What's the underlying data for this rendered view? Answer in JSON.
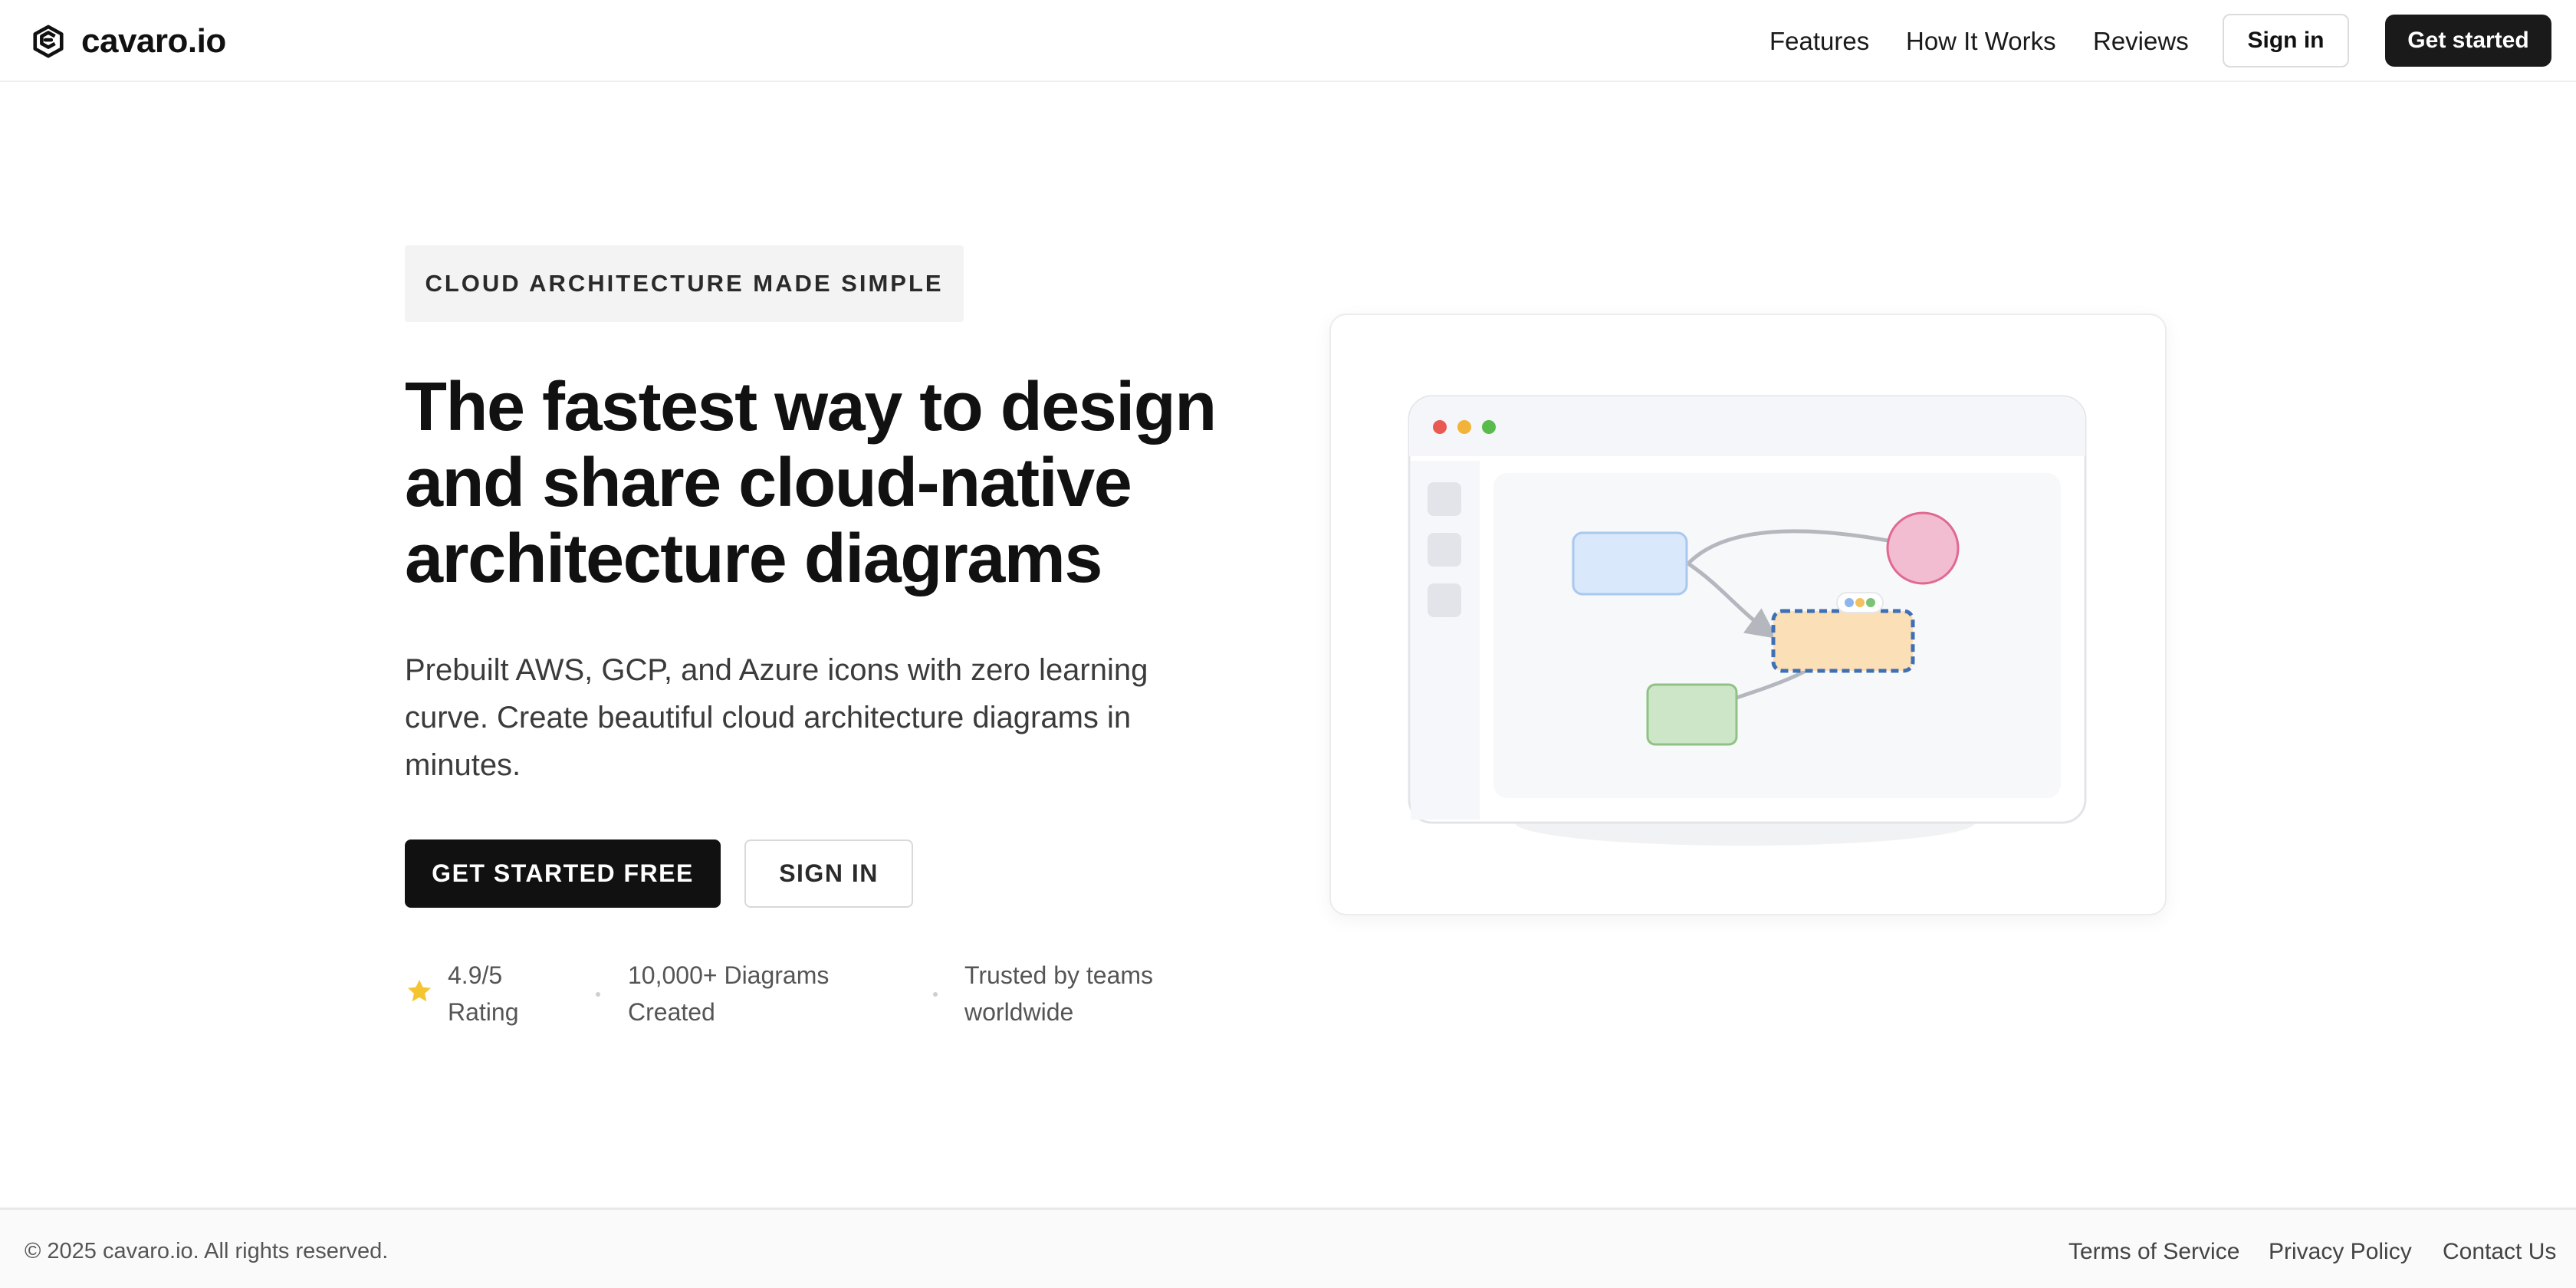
{
  "nav": {
    "brand": "cavaro.io",
    "links": [
      "Features",
      "How It Works",
      "Reviews"
    ],
    "sign_in": "Sign in",
    "get_started": "Get started"
  },
  "hero": {
    "eyebrow": "CLOUD ARCHITECTURE MADE SIMPLE",
    "headline_lines": [
      "The fastest way to design",
      "and share cloud-native",
      "architecture diagrams"
    ],
    "subhead_lines": [
      "Prebuilt AWS, GCP, and Azure icons with zero learning",
      "curve. Create beautiful cloud architecture diagrams in",
      "minutes."
    ],
    "cta_primary": "GET STARTED FREE",
    "cta_secondary": "SIGN IN",
    "stats": [
      {
        "line1": "4.9/5",
        "line2": "Rating"
      },
      {
        "line1": "10,000+ Diagrams",
        "line2": "Created"
      },
      {
        "line1": "Trusted by teams",
        "line2": "worldwide"
      }
    ]
  },
  "footer": {
    "copyright": "© 2025 cavaro.io. All rights reserved.",
    "links": [
      "Terms of Service",
      "Privacy Policy",
      "Contact Us"
    ]
  },
  "colors": {
    "accent": "#111111",
    "star": "#f5c531",
    "node_blue": "#d9e8fb",
    "node_pink": "#f2bcd1",
    "node_orange": "#fbdfb6",
    "node_green": "#cde6c8",
    "selection": "#3f6fb4"
  },
  "icons": {
    "brand": "cube-logo-icon",
    "rating": "star-icon"
  }
}
